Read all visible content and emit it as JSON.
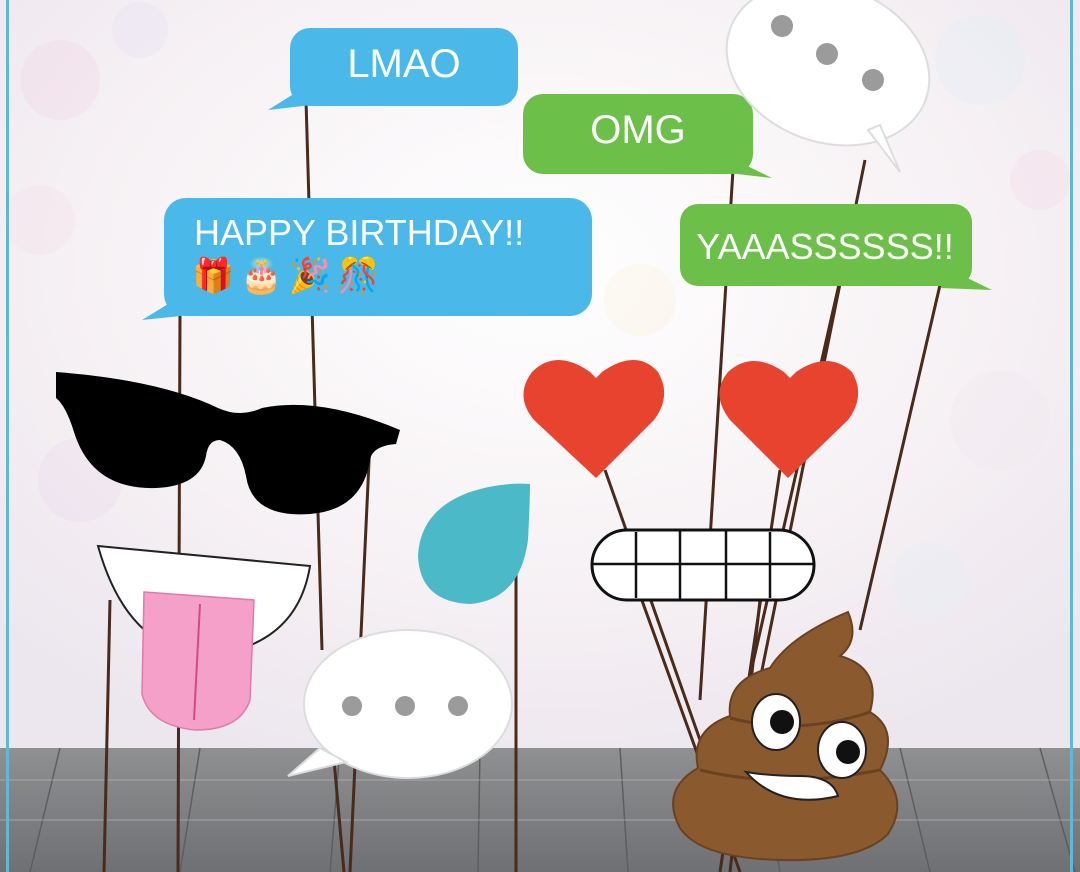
{
  "bubbles": {
    "lmao": "LMAO",
    "omg": "OMG",
    "happy_birthday": "HAPPY BIRTHDAY!!",
    "yaas": "YAAASSSSSS!!",
    "birthday_emojis": "🎁🎂🎉🎊"
  },
  "colors": {
    "blue_bubble": "#4ab8e8",
    "green_bubble": "#6cc04a",
    "heart": "#e8432e",
    "drop": "#4bb9c8",
    "tongue": "#f4a0c8",
    "poop": "#8a5a2e",
    "stick": "#4a2a1a",
    "floor": "#a9a9a9"
  },
  "props": [
    "speech-bubble-lmao",
    "speech-bubble-omg",
    "speech-bubble-happy-birthday",
    "speech-bubble-yaas",
    "speech-bubble-ellipsis-top",
    "speech-bubble-ellipsis-bottom",
    "sunglasses",
    "tongue-mouth",
    "teardrop",
    "heart-eyes",
    "grin-teeth",
    "poop-emoji"
  ]
}
